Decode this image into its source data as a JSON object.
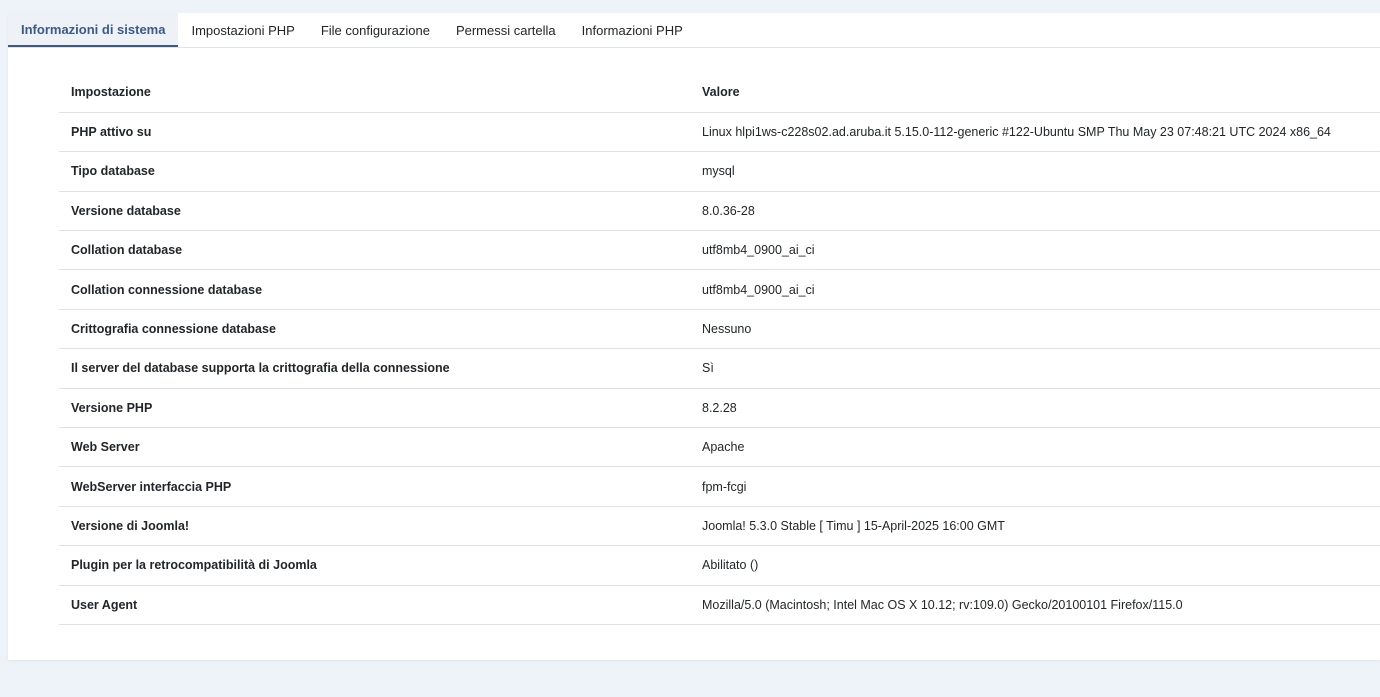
{
  "tabs": [
    {
      "label": "Informazioni di sistema",
      "active": true
    },
    {
      "label": "Impostazioni PHP",
      "active": false
    },
    {
      "label": "File configurazione",
      "active": false
    },
    {
      "label": "Permessi cartella",
      "active": false
    },
    {
      "label": "Informazioni PHP",
      "active": false
    }
  ],
  "table": {
    "headers": {
      "setting": "Impostazione",
      "value": "Valore"
    },
    "rows": [
      {
        "setting": "PHP attivo su",
        "value": "Linux hlpi1ws-c228s02.ad.aruba.it 5.15.0-112-generic #122-Ubuntu SMP Thu May 23 07:48:21 UTC 2024 x86_64"
      },
      {
        "setting": "Tipo database",
        "value": "mysql"
      },
      {
        "setting": "Versione database",
        "value": "8.0.36-28"
      },
      {
        "setting": "Collation database",
        "value": "utf8mb4_0900_ai_ci"
      },
      {
        "setting": "Collation connessione database",
        "value": "utf8mb4_0900_ai_ci"
      },
      {
        "setting": "Crittografia connessione database",
        "value": "Nessuno"
      },
      {
        "setting": "Il server del database supporta la crittografia della connessione",
        "value": "Sì"
      },
      {
        "setting": "Versione PHP",
        "value": "8.2.28"
      },
      {
        "setting": "Web Server",
        "value": "Apache"
      },
      {
        "setting": "WebServer interfaccia PHP",
        "value": "fpm-fcgi"
      },
      {
        "setting": "Versione di Joomla!",
        "value": "Joomla! 5.3.0 Stable [ Timu ] 15-April-2025 16:00 GMT"
      },
      {
        "setting": "Plugin per la retrocompatibilità di Joomla",
        "value": "Abilitato ()"
      },
      {
        "setting": "User Agent",
        "value": "Mozilla/5.0 (Macintosh; Intel Mac OS X 10.12; rv:109.0) Gecko/20100101 Firefox/115.0"
      }
    ]
  }
}
